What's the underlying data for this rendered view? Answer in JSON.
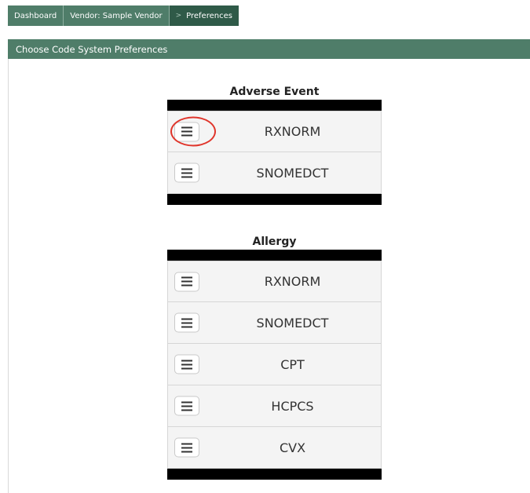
{
  "breadcrumb": {
    "items": [
      "Dashboard",
      "Vendor: Sample Vendor",
      "Preferences"
    ]
  },
  "panel": {
    "title": "Choose Code System Preferences"
  },
  "sections": [
    {
      "title": "Adverse Event",
      "items": [
        "RXNORM",
        "SNOMEDCT"
      ]
    },
    {
      "title": "Allergy",
      "items": [
        "RXNORM",
        "SNOMEDCT",
        "CPT",
        "HCPCS",
        "CVX"
      ]
    }
  ],
  "drag_handle_icon": "hamburger-menu-icon",
  "highlight_color": "#e0352b",
  "theme": {
    "primary": "#4f7d69",
    "active_crumb": "#2f5a48"
  }
}
